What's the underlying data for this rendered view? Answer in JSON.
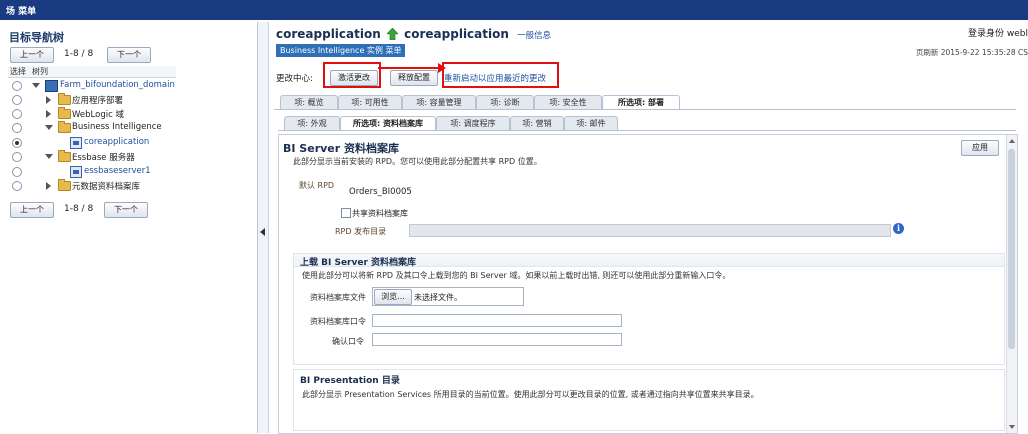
{
  "topbar": {
    "title": "场 菜单"
  },
  "left": {
    "title": "目标导航树",
    "prev_label": "上一个",
    "next_label": "下一个",
    "pager": "1-8 / 8",
    "col_select": "选择",
    "col_tree": "树列",
    "items": [
      {
        "label": "Farm_bifoundation_domain"
      },
      {
        "label": "应用程序部署"
      },
      {
        "label": "WebLogic 域"
      },
      {
        "label": "Business Intelligence"
      },
      {
        "label": "coreapplication"
      },
      {
        "label": "Essbase 服务器"
      },
      {
        "label": "essbaseserver1"
      },
      {
        "label": "元数据资料档案库"
      }
    ]
  },
  "header": {
    "title1": "coreapplication",
    "title2": "coreapplication",
    "info_link": "一般信息",
    "bi_menu": "Business Intelligence 实例 菜单",
    "login": "登录身份 webl",
    "page_refresh": "页刷新 2015-9-22 15:35:28 CS"
  },
  "changes": {
    "label": "更改中心:",
    "activate": "激活更改",
    "release": "释放配置",
    "restart": "重新启动以应用最近的更改"
  },
  "tabs_row1": [
    {
      "label": "项: 概览"
    },
    {
      "label": "项: 可用性"
    },
    {
      "label": "项: 容量管理"
    },
    {
      "label": "项: 诊断"
    },
    {
      "label": "项: 安全性"
    },
    {
      "label": "所选项: 部署"
    }
  ],
  "tabs_row2": [
    {
      "label": "项: 外观"
    },
    {
      "label": "所选项: 资料档案库"
    },
    {
      "label": "项: 调度程序"
    },
    {
      "label": "项: 营销"
    },
    {
      "label": "项: 邮件"
    }
  ],
  "bi_server": {
    "title": "BI Server 资料档案库",
    "desc": "此部分显示当前安装的 RPD。您可以使用此部分配置共享 RPD 位置。",
    "apply": "应用",
    "default_rpd_label": "默认 RPD",
    "default_rpd_value": "Orders_BI0005",
    "shared_repo_label": "共享资料档案库",
    "rpd_publish_label": "RPD 发布目录"
  },
  "upload": {
    "title": "上载 BI Server 资料档案库",
    "desc": "使用此部分可以将新 RPD 及其口令上载到您的 BI Server 域。如果以前上载时出错, 则还可以使用此部分重新输入口令。",
    "file_label": "资料档案库文件",
    "browse": "浏览...",
    "no_file": "未选择文件。",
    "password_label": "资料档案库口令",
    "confirm_label": "确认口令"
  },
  "presentation": {
    "title": "BI Presentation 目录",
    "desc": "此部分显示 Presentation Services 所用目录的当前位置。使用此部分可以更改目录的位置, 或者通过指向共享位置来共享目录。"
  },
  "colors": {
    "topbar": "#1a3a82",
    "bi_menu": "#2e6fb8",
    "highlight": "#e01010",
    "link": "#1d4fa0"
  }
}
